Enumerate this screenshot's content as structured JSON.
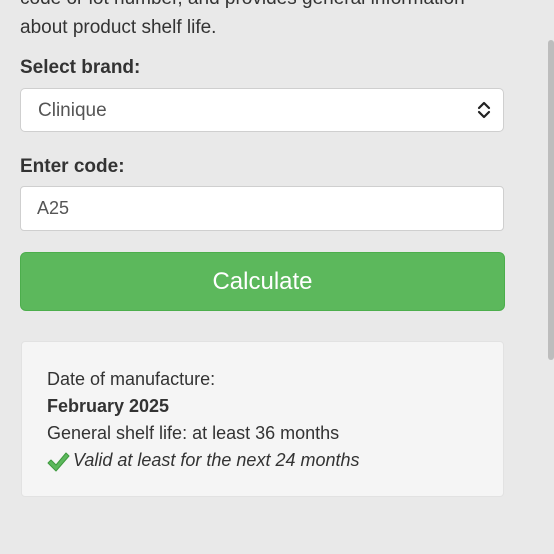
{
  "intro": {
    "line1": "code or lot number, and provides general information",
    "line2": "about product shelf life."
  },
  "brand": {
    "label": "Select brand:",
    "selected": "Clinique"
  },
  "code": {
    "label": "Enter code:",
    "value": "A25"
  },
  "button": {
    "label": "Calculate"
  },
  "result": {
    "manufacture_label": "Date of manufacture:",
    "manufacture_date": "February 2025",
    "shelf_life": "General shelf life: at least 36 months",
    "validity": "Valid at least for the next 24 months"
  },
  "colors": {
    "accent": "#5cb85c",
    "check": "#4cae4c"
  },
  "icons": {
    "select": "chevron-up-down-icon",
    "validity": "check-icon"
  }
}
